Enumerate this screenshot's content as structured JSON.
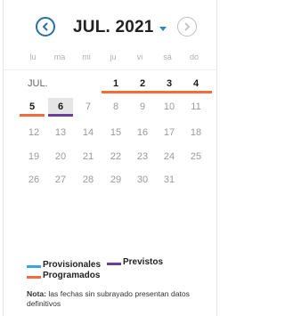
{
  "header": {
    "month_label": "JUL. 2021"
  },
  "weekdays": [
    "lu",
    "ma",
    "mi",
    "ju",
    "vi",
    "sá",
    "do"
  ],
  "calendar": {
    "month_prefix": "JUL.",
    "days": [
      "1",
      "2",
      "3",
      "4",
      "5",
      "6",
      "7",
      "8",
      "9",
      "10",
      "11",
      "12",
      "13",
      "14",
      "15",
      "16",
      "17",
      "18",
      "19",
      "20",
      "21",
      "22",
      "23",
      "24",
      "25",
      "26",
      "27",
      "28",
      "29",
      "30",
      "31"
    ],
    "today": "6"
  },
  "legend": {
    "provisionales": "Provisionales",
    "previstos": "Previstos",
    "programados": "Programados"
  },
  "note": {
    "label": "Nota:",
    "text": " las fechas sin subrayado presentan datos definitivos"
  },
  "colors": {
    "programados": "#f36c3d",
    "previstos": "#6a3fa0",
    "provisionales": "#35a8e0",
    "accent": "#2c6fa3"
  }
}
